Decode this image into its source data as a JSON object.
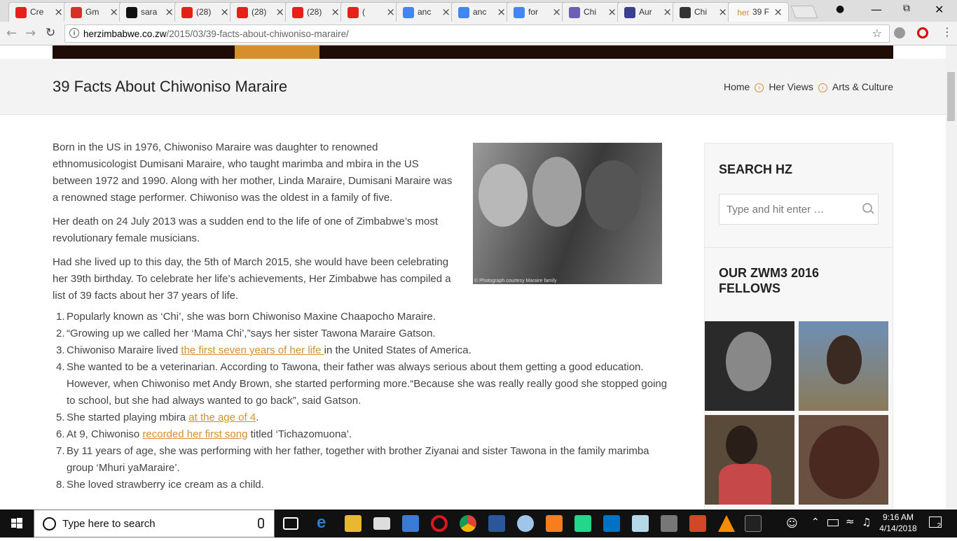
{
  "browser": {
    "tabs": [
      {
        "title": "Cre",
        "favicon": "youtube-icon",
        "color": "#e62117"
      },
      {
        "title": "Gm",
        "favicon": "gmail-icon",
        "color": "#d93025"
      },
      {
        "title": "sara",
        "favicon": "github-icon",
        "color": "#111111"
      },
      {
        "title": "(28)",
        "favicon": "youtube-icon",
        "color": "#e62117"
      },
      {
        "title": "(28)",
        "favicon": "youtube-icon",
        "color": "#e62117"
      },
      {
        "title": "(28)",
        "favicon": "youtube-icon",
        "color": "#e62117"
      },
      {
        "title": "(",
        "favicon": "youtube-icon",
        "color": "#e62117"
      },
      {
        "title": "anc",
        "favicon": "google-icon",
        "color": "#4285f4"
      },
      {
        "title": "anc",
        "favicon": "google-icon",
        "color": "#4285f4"
      },
      {
        "title": "for",
        "favicon": "google-icon",
        "color": "#4285f4"
      },
      {
        "title": "Chi",
        "favicon": "music-icon",
        "color": "#6b5fb5"
      },
      {
        "title": "Aur",
        "favicon": "s-icon",
        "color": "#3b3f8f"
      },
      {
        "title": "Chi",
        "favicon": "wikipedia-icon",
        "color": "#333333"
      },
      {
        "title": "39 F",
        "favicon": "her-icon",
        "color": "#d58f2c",
        "favicon_text": "her"
      }
    ],
    "url_domain": "herzimbabwe.co.zw",
    "url_path": "/2015/03/39-facts-about-chiwoniso-maraire/"
  },
  "page": {
    "title": "39 Facts About Chiwoniso Maraire",
    "breadcrumbs": [
      "Home",
      "Her Views",
      "Arts & Culture"
    ],
    "paragraphs": [
      "Born in the US in 1976, Chiwoniso Maraire was daughter to renowned ethnomusicologist Dumisani Maraire, who taught marimba and mbira in the US between 1972 and 1990. Along with her mother, Linda Maraire, Dumisani Maraire was a renowned stage performer. Chiwoniso was the oldest in a family of five.",
      "Her death on 24 July 2013 was a sudden end to the life of one of Zimbabwe’s most revolutionary female musicians.",
      "Had she lived up to this day, the 5th of March 2015, she would have been celebrating her 39th birthday. To celebrate her life’s achievements, Her Zimbabwe has compiled a list of 39 facts about her 37 years of life."
    ],
    "photo_caption": "© Photograph courtesy Maraire family",
    "facts": [
      {
        "num": "1.",
        "before": "Popularly known as ‘Chi’, she was born Chiwoniso Maxine Chaapocho Maraire.",
        "link": "",
        "after": ""
      },
      {
        "num": "2.",
        "before": "“Growing up we called her ‘Mama Chi’,”says her sister Tawona Maraire Gatson.",
        "link": "",
        "after": ""
      },
      {
        "num": "3.",
        "before": "Chiwoniso Maraire lived ",
        "link": "the first seven years of her life ",
        "after": "in the United States of America."
      },
      {
        "num": "4.",
        "before": "She wanted to be a veterinarian. According to Tawona, their father was always serious about them getting a good education. However, when Chiwoniso met Andy Brown, she started performing more.“Because she was really really good she stopped going to school, but she had always wanted to go back”, said Gatson.",
        "link": "",
        "after": ""
      },
      {
        "num": "5.",
        "before": "She started playing mbira ",
        "link": "at the age of 4",
        "after": "."
      },
      {
        "num": "6.",
        "before": "At 9, Chiwoniso ",
        "link": "recorded her first song",
        "after": " titled ‘Tichazomuona’."
      },
      {
        "num": "7.",
        "before": "By 11 years of age, she was performing with her father, together with brother Ziyanai and sister Tawona in the family marimba group ‘Mhuri yaMaraire’.",
        "link": "",
        "after": ""
      },
      {
        "num": "8.",
        "before": "She loved strawberry ice cream as a child.",
        "link": "",
        "after": ""
      }
    ]
  },
  "sidebar": {
    "search_title": "SEARCH HZ",
    "search_placeholder": "Type and hit enter …",
    "fellows_title": "OUR ZWM3 2016 FELLOWS"
  },
  "taskbar": {
    "search_text": "Type here to search",
    "time": "9:16 AM",
    "date": "4/14/2018",
    "notification_count": "2"
  },
  "colors": {
    "accent": "#d58f2c",
    "header_dark": "#1f0c06"
  }
}
